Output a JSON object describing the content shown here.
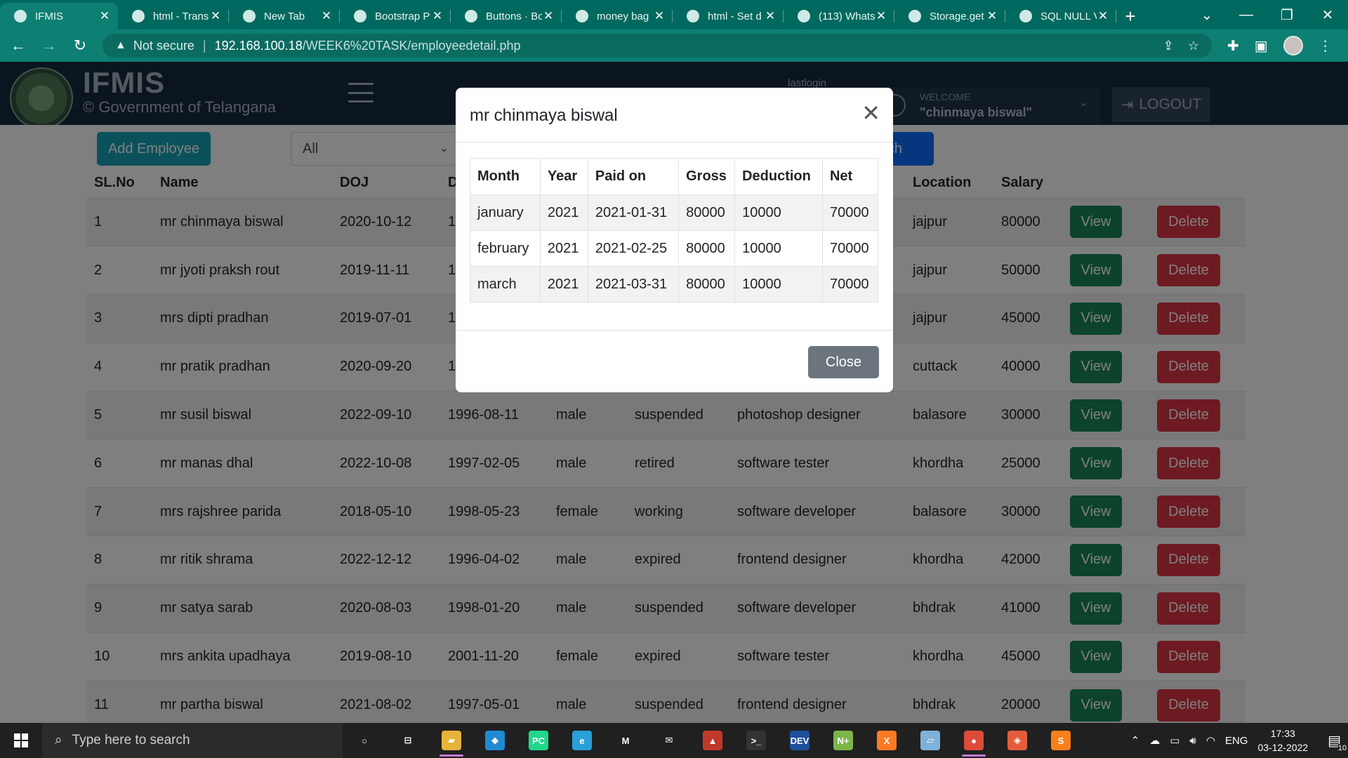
{
  "browser": {
    "tabs": [
      {
        "title": "IFMIS",
        "icon": "ifmis-favicon",
        "active": true
      },
      {
        "title": "html - Trans",
        "icon": "stackoverflow-favicon"
      },
      {
        "title": "New Tab",
        "icon": "chrome-favicon"
      },
      {
        "title": "Bootstrap P",
        "icon": "mdn-favicon"
      },
      {
        "title": "Buttons · Bo",
        "icon": "bootstrap-favicon"
      },
      {
        "title": "money bag",
        "icon": "google-favicon"
      },
      {
        "title": "html - Set d",
        "icon": "stackoverflow-favicon"
      },
      {
        "title": "(113) Whats",
        "icon": "whatsapp-favicon"
      },
      {
        "title": "Storage.get",
        "icon": "medium-favicon"
      },
      {
        "title": "SQL NULL V",
        "icon": "w3schools-favicon"
      }
    ],
    "address": {
      "security": "Not secure",
      "host": "192.168.100.18",
      "path": "/WEEK6%20TASK/employeedetail.php"
    }
  },
  "header": {
    "brand_title": "IFMIS",
    "brand_sub": "© Government of Telangana",
    "lastlogin_label": "lastlogin",
    "welcome_label": "WELCOME",
    "welcome_name": "\"chinmaya biswal\"",
    "logout_label": "LOGOUT"
  },
  "toolbar": {
    "add_employee": "Add Employee",
    "filter_value": "All",
    "search_label": "earch"
  },
  "table": {
    "columns": [
      "SL.No",
      "Name",
      "DOJ",
      "D",
      "",
      "",
      "",
      "Location",
      "Salary",
      "",
      ""
    ],
    "view_label": "View",
    "delete_label": "Delete",
    "rows": [
      {
        "sl": "1",
        "name": "mr chinmaya biswal",
        "doj": "2020-10-12",
        "dob": "1",
        "gender": "",
        "status": "",
        "designation": "",
        "location": "jajpur",
        "salary": "80000"
      },
      {
        "sl": "2",
        "name": "mr jyoti praksh rout",
        "doj": "2019-11-11",
        "dob": "1",
        "gender": "",
        "status": "",
        "designation": "",
        "location": "jajpur",
        "salary": "50000"
      },
      {
        "sl": "3",
        "name": "mrs dipti pradhan",
        "doj": "2019-07-01",
        "dob": "1",
        "gender": "",
        "status": "",
        "designation": "",
        "location": "jajpur",
        "salary": "45000"
      },
      {
        "sl": "4",
        "name": "mr pratik pradhan",
        "doj": "2020-09-20",
        "dob": "1",
        "gender": "",
        "status": "",
        "designation": "",
        "location": "cuttack",
        "salary": "40000"
      },
      {
        "sl": "5",
        "name": "mr susil biswal",
        "doj": "2022-09-10",
        "dob": "1996-08-11",
        "gender": "male",
        "status": "suspended",
        "designation": "photoshop designer",
        "location": "balasore",
        "salary": "30000"
      },
      {
        "sl": "6",
        "name": "mr manas dhal",
        "doj": "2022-10-08",
        "dob": "1997-02-05",
        "gender": "male",
        "status": "retired",
        "designation": "software tester",
        "location": "khordha",
        "salary": "25000"
      },
      {
        "sl": "7",
        "name": "mrs rajshree parida",
        "doj": "2018-05-10",
        "dob": "1998-05-23",
        "gender": "female",
        "status": "working",
        "designation": "software developer",
        "location": "balasore",
        "salary": "30000"
      },
      {
        "sl": "8",
        "name": "mr ritik shrama",
        "doj": "2022-12-12",
        "dob": "1996-04-02",
        "gender": "male",
        "status": "expired",
        "designation": "frontend designer",
        "location": "khordha",
        "salary": "42000"
      },
      {
        "sl": "9",
        "name": "mr satya sarab",
        "doj": "2020-08-03",
        "dob": "1998-01-20",
        "gender": "male",
        "status": "suspended",
        "designation": "software developer",
        "location": "bhdrak",
        "salary": "41000"
      },
      {
        "sl": "10",
        "name": "mrs ankita upadhaya",
        "doj": "2019-08-10",
        "dob": "2001-11-20",
        "gender": "female",
        "status": "expired",
        "designation": "software tester",
        "location": "khordha",
        "salary": "45000"
      },
      {
        "sl": "11",
        "name": "mr partha biswal",
        "doj": "2021-08-02",
        "dob": "1997-05-01",
        "gender": "male",
        "status": "suspended",
        "designation": "frontend designer",
        "location": "bhdrak",
        "salary": "20000"
      }
    ]
  },
  "modal": {
    "title": "mr chinmaya biswal",
    "columns": [
      "Month",
      "Year",
      "Paid on",
      "Gross",
      "Deduction",
      "Net"
    ],
    "rows": [
      [
        "january",
        "2021",
        "2021-01-31",
        "80000",
        "10000",
        "70000"
      ],
      [
        "february",
        "2021",
        "2021-02-25",
        "80000",
        "10000",
        "70000"
      ],
      [
        "march",
        "2021",
        "2021-03-31",
        "80000",
        "10000",
        "70000"
      ]
    ],
    "close_label": "Close"
  },
  "taskbar": {
    "search_placeholder": "Type here to search",
    "apps": [
      "task-view",
      "widgets",
      "file-explorer",
      "vscode",
      "pycharm",
      "edge",
      "mathstudio",
      "mail",
      "game",
      "terminal",
      "dev-tool",
      "notepad-plus",
      "xampp",
      "folder-tool",
      "chrome",
      "git-tool",
      "sublime"
    ],
    "lang": "ENG",
    "time": "17:33",
    "date": "03-12-2022",
    "notifications": "10"
  },
  "colors": {
    "chrome_tabstrip": "#00695f",
    "chrome_toolbar": "#0d7f73",
    "header_bg": "#162b3f",
    "add_button": "#17a2b8",
    "view_button": "#198754",
    "delete_button": "#dc3545",
    "close_button": "#6c757d"
  }
}
